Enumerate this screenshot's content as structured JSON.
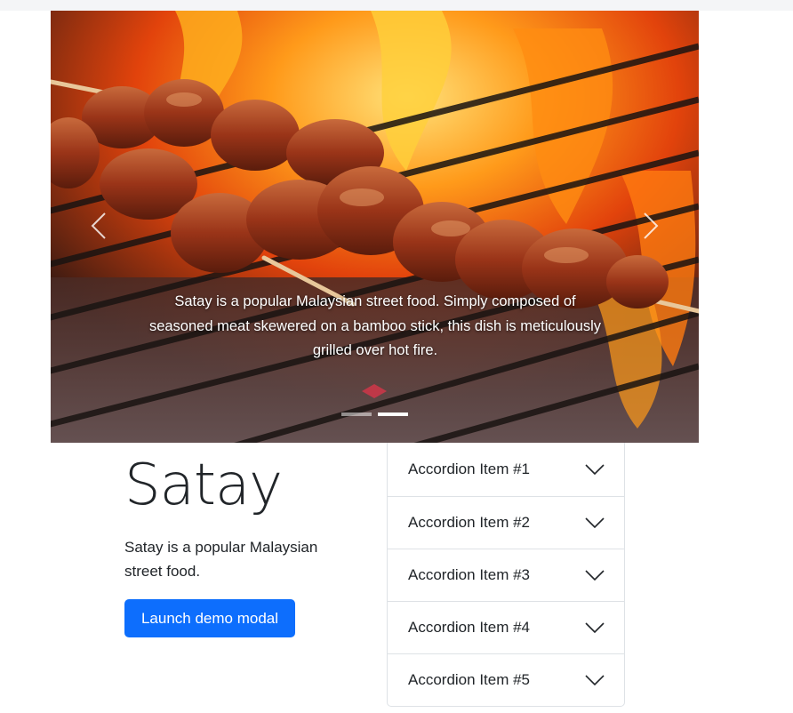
{
  "carousel": {
    "caption": "Satay is a popular Malaysian street food. Simply composed of seasoned meat skewered on a bamboo stick, this dish is meticulously grilled over hot fire.",
    "slide_count": 2,
    "active_slide": 2,
    "prev_icon": "chevron-left-icon",
    "next_icon": "chevron-right-icon"
  },
  "hero": {
    "title": "Satay",
    "lead": "Satay is a popular Malaysian street food.",
    "button_label": "Launch demo modal",
    "button_color": "#0d6efd"
  },
  "accordion": {
    "items": [
      {
        "label": "Accordion Item #1"
      },
      {
        "label": "Accordion Item #2"
      },
      {
        "label": "Accordion Item #3"
      },
      {
        "label": "Accordion Item #4"
      },
      {
        "label": "Accordion Item #5"
      }
    ],
    "chevron_icon": "chevron-down-icon"
  }
}
